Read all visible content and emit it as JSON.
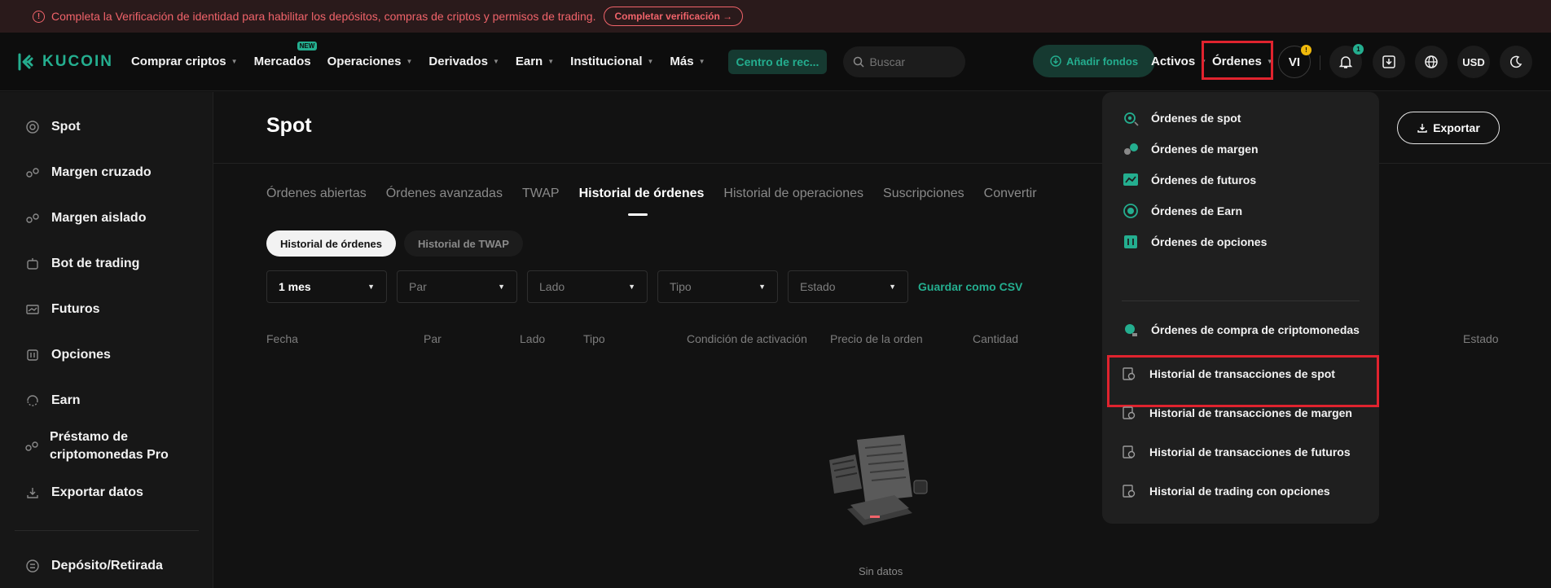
{
  "banner": {
    "message": "Completa la Verificación de identidad para habilitar los depósitos, compras de criptos y permisos de trading.",
    "button": "Completar verificación →"
  },
  "header": {
    "logo": "KUCOIN",
    "nav": [
      {
        "label": "Comprar criptos"
      },
      {
        "label": "Mercados",
        "badge": "NEW"
      },
      {
        "label": "Operaciones"
      },
      {
        "label": "Derivados"
      },
      {
        "label": "Earn"
      },
      {
        "label": "Institucional"
      },
      {
        "label": "Más"
      }
    ],
    "centro": "Centro de rec...",
    "search_placeholder": "Buscar",
    "add_funds": "Añadir fondos",
    "activos": "Activos",
    "ordenes": "Órdenes",
    "avatar": "VI",
    "notification_count": "1",
    "currency": "USD"
  },
  "sidebar": {
    "items": [
      {
        "label": "Spot",
        "icon": "spot-icon"
      },
      {
        "label": "Margen cruzado",
        "icon": "cross-margin-icon"
      },
      {
        "label": "Margen aislado",
        "icon": "isolated-margin-icon"
      },
      {
        "label": "Bot de trading",
        "icon": "bot-icon"
      },
      {
        "label": "Futuros",
        "icon": "futures-icon"
      },
      {
        "label": "Opciones",
        "icon": "options-icon"
      },
      {
        "label": "Earn",
        "icon": "earn-icon"
      },
      {
        "label": "Préstamo de criptomonedas Pro",
        "icon": "loan-icon"
      },
      {
        "label": "Exportar datos",
        "icon": "export-icon"
      },
      {
        "label": "Depósito/Retirada",
        "icon": "deposit-icon"
      }
    ]
  },
  "main": {
    "title": "Spot",
    "export": "Exportar",
    "tabs": [
      "Órdenes abiertas",
      "Órdenes avanzadas",
      "TWAP",
      "Historial de órdenes",
      "Historial de operaciones",
      "Suscripciones",
      "Convertir"
    ],
    "active_tab": "Historial de órdenes",
    "subtabs": [
      "Historial de órdenes",
      "Historial de TWAP"
    ],
    "filters": {
      "period": "1 mes",
      "pair": "Par",
      "side": "Lado",
      "type": "Tipo",
      "status": "Estado",
      "csv": "Guardar como CSV"
    },
    "columns": [
      "Fecha",
      "Par",
      "Lado",
      "Tipo",
      "Condición de activación",
      "Precio de la orden",
      "Cantidad",
      "Estado"
    ],
    "empty": "Sin datos"
  },
  "dropdown": {
    "items": [
      {
        "label": "Órdenes de spot",
        "icon": "spot-orders-icon"
      },
      {
        "label": "Órdenes de margen",
        "icon": "margin-orders-icon"
      },
      {
        "label": "Órdenes de futuros",
        "icon": "futures-orders-icon"
      },
      {
        "label": "Órdenes de Earn",
        "icon": "earn-orders-icon"
      },
      {
        "label": "Órdenes de opciones",
        "icon": "options-orders-icon"
      },
      {
        "label": "Órdenes de compra de criptomonedas",
        "icon": "crypto-purchase-icon"
      },
      {
        "label": "Historial de transacciones de spot",
        "icon": "history-icon"
      },
      {
        "label": "Historial de transacciones de margen",
        "icon": "history-icon"
      },
      {
        "label": "Historial de transacciones de futuros",
        "icon": "history-icon"
      },
      {
        "label": "Historial de trading con opciones",
        "icon": "history-icon"
      }
    ]
  },
  "colors": {
    "accent": "#24ae8f",
    "highlight": "#e0232e",
    "warning": "#f0636a"
  }
}
